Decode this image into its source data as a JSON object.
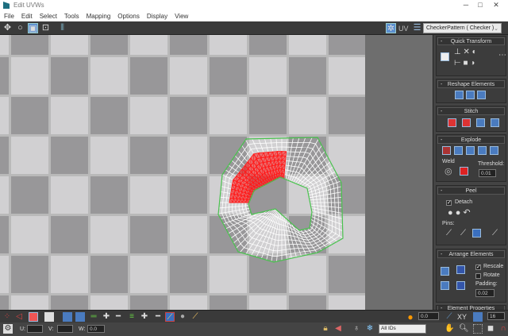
{
  "window": {
    "title": "Edit UVWs",
    "controls": [
      "minimize",
      "maximize",
      "close"
    ]
  },
  "menu": [
    "File",
    "Edit",
    "Select",
    "Tools",
    "Mapping",
    "Options",
    "Display",
    "View"
  ],
  "toolbar": {
    "tools": [
      "move-icon",
      "rotate-icon",
      "scale-icon",
      "freeform-icon",
      "mirror-icon"
    ],
    "uv_label": "UV",
    "texture_dropdown": "CheckerPattern ( Checker )"
  },
  "panel": {
    "quick_transform": "Quick Transform",
    "reshape": "Reshape Elements",
    "stitch": "Stitch",
    "explode": "Explode",
    "weld": "Weld",
    "threshold_label": "Threshold:",
    "threshold_value": "0.01",
    "peel": "Peel",
    "detach_label": "Detach",
    "detach_checked": true,
    "pins_label": "Pins:",
    "arrange": "Arrange Elements",
    "rescale_label": "Rescale",
    "rescale_checked": true,
    "rotate_label": "Rotate",
    "rotate_checked": false,
    "padding_label": "Padding:",
    "padding_value": "0.02",
    "element_properties": "Element Properties"
  },
  "bottom": {
    "u_label": "U:",
    "u_value": "",
    "v_label": "V:",
    "v_value": "",
    "w_label": "W:",
    "w_value": "0.0",
    "soft_value": "0.0",
    "xy_label": "XY",
    "grid_value": "16",
    "ids_dropdown": "All IDs"
  },
  "colors": {
    "checker_light": "#d1d0d2",
    "checker_dark": "#989799",
    "selection": "#ff1a1a",
    "mesh": "#ffffff",
    "boundary": "#49c24e",
    "accent": "#4a7bbf"
  }
}
